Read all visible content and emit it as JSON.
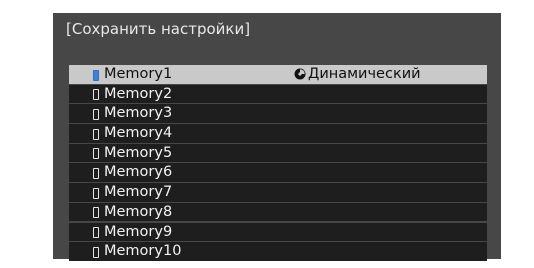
{
  "dialog": {
    "title": "[Сохранить настройки]"
  },
  "memory_list": [
    {
      "label": "Memory1",
      "mode": "Динамический",
      "selected": true
    },
    {
      "label": "Memory2",
      "mode": ""
    },
    {
      "label": "Memory3",
      "mode": ""
    },
    {
      "label": "Memory4",
      "mode": ""
    },
    {
      "label": "Memory5",
      "mode": ""
    },
    {
      "label": "Memory6",
      "mode": ""
    },
    {
      "label": "Memory7",
      "mode": ""
    },
    {
      "label": "Memory8",
      "mode": ""
    },
    {
      "label": "Memory9",
      "mode": ""
    },
    {
      "label": "Memory10",
      "mode": ""
    }
  ],
  "icons": {
    "slot": "memory-slot-icon",
    "mode": "color-mode-icon"
  },
  "colors": {
    "selected_slot": "#3b83d9",
    "selected_row": "#c9c9c9",
    "row": "#1e1e1e",
    "panel": "#474747"
  }
}
